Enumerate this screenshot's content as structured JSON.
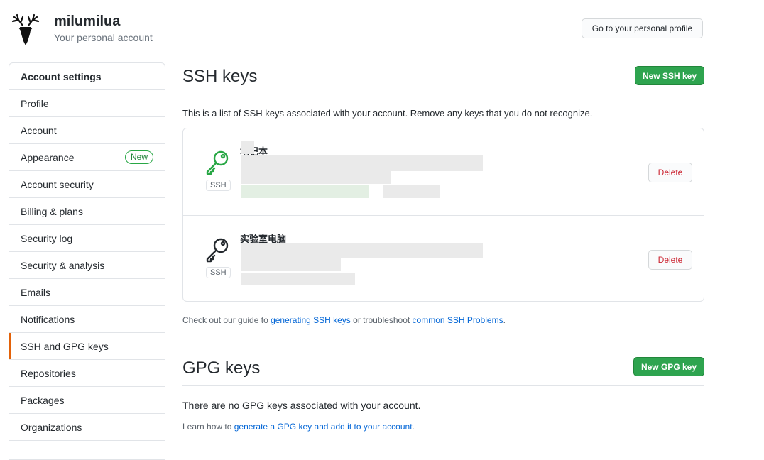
{
  "account": {
    "name": "milumilua",
    "subtitle": "Your personal account",
    "profile_button": "Go to your personal profile"
  },
  "sidebar": {
    "header": "Account settings",
    "items": [
      {
        "label": "Profile"
      },
      {
        "label": "Account"
      },
      {
        "label": "Appearance",
        "badge": "New"
      },
      {
        "label": "Account security"
      },
      {
        "label": "Billing & plans"
      },
      {
        "label": "Security log"
      },
      {
        "label": "Security & analysis"
      },
      {
        "label": "Emails"
      },
      {
        "label": "Notifications"
      },
      {
        "label": "SSH and GPG keys",
        "selected": true
      },
      {
        "label": "Repositories"
      },
      {
        "label": "Packages"
      },
      {
        "label": "Organizations"
      }
    ]
  },
  "ssh": {
    "title": "SSH keys",
    "new_button": "New SSH key",
    "description": "This is a list of SSH keys associated with your account. Remove any keys that you do not recognize.",
    "keys": [
      {
        "title": "笔记本",
        "type_label": "SSH",
        "delete_label": "Delete",
        "icon_color": "#28a745"
      },
      {
        "title": "实验室电脑",
        "type_label": "SSH",
        "delete_label": "Delete",
        "icon_color": "#24292e"
      }
    ],
    "guide": {
      "prefix": "Check out our guide to ",
      "link1": "generating SSH keys",
      "middle": " or troubleshoot ",
      "link2": "common SSH Problems",
      "suffix": "."
    }
  },
  "gpg": {
    "title": "GPG keys",
    "new_button": "New GPG key",
    "empty_text": "There are no GPG keys associated with your account.",
    "learn": {
      "prefix": "Learn how to ",
      "link": "generate a GPG key and add it to your account",
      "suffix": "."
    }
  },
  "colors": {
    "accent_green": "#2ea44f",
    "link_blue": "#0366d6",
    "danger_red": "#cb2431",
    "selected_marker": "#e36209"
  }
}
